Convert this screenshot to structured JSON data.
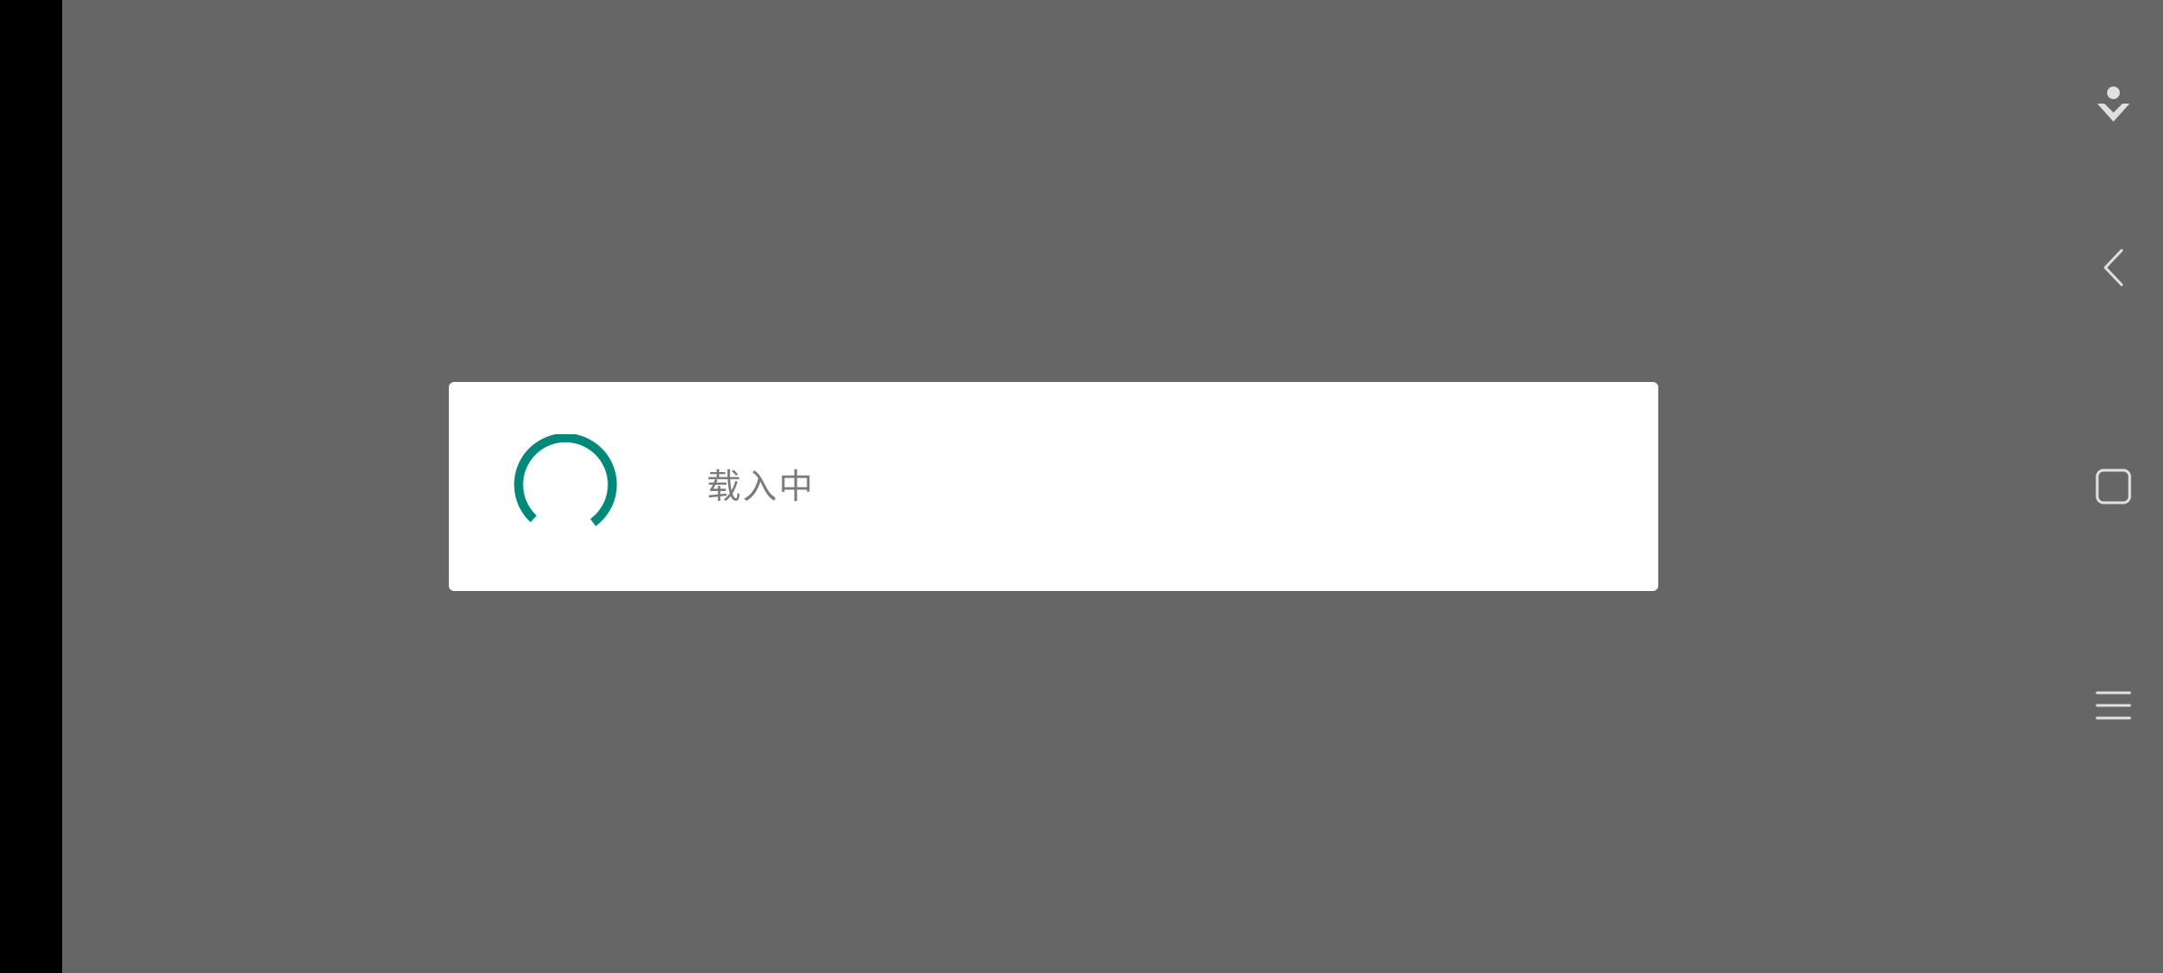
{
  "dialog": {
    "message": "载入中"
  },
  "spinner": {
    "color": "#00897b",
    "icon": "spinner-icon"
  },
  "nav_bar": {
    "buttons": [
      {
        "name": "accessibility-button",
        "icon": "accessibility-icon"
      },
      {
        "name": "back-button",
        "icon": "back-chevron-icon"
      },
      {
        "name": "home-button",
        "icon": "home-square-icon"
      },
      {
        "name": "recents-button",
        "icon": "menu-lines-icon"
      }
    ],
    "icon_color": "#e0e0e0"
  },
  "colors": {
    "scrim": "#666666",
    "dialog_bg": "#ffffff",
    "text": "#7a7a7a"
  }
}
